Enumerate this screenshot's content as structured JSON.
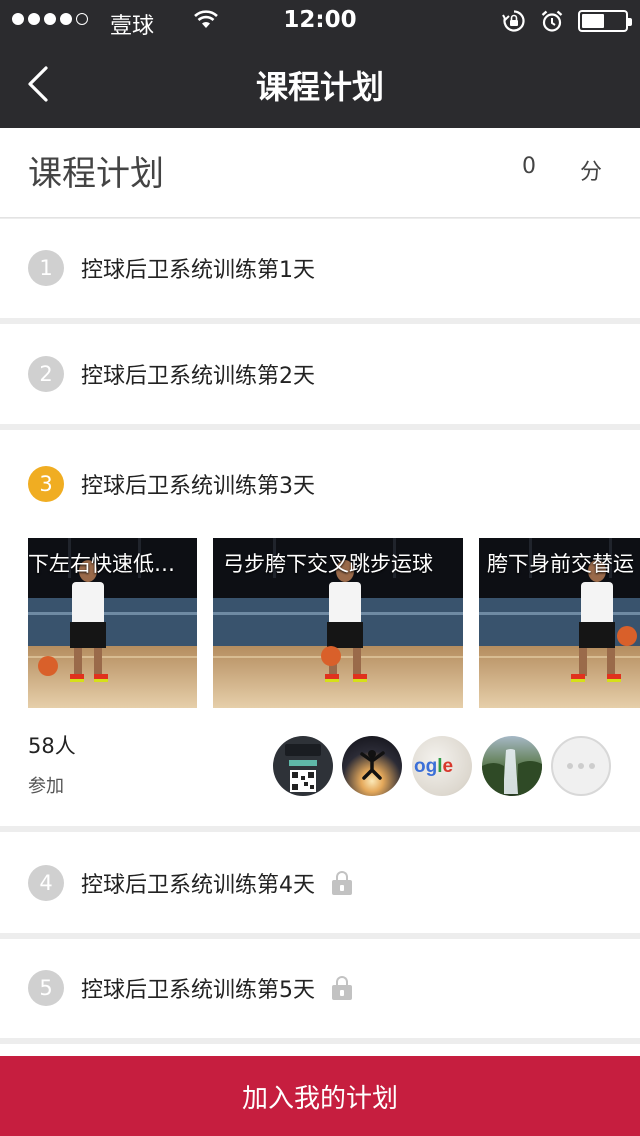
{
  "status_bar": {
    "signal_bars_filled": 4,
    "signal_bars_total": 5,
    "carrier": "壹球",
    "time": "12:00",
    "battery_level": 0.5,
    "icons": [
      "wifi-icon",
      "rotation-lock-icon",
      "alarm-icon",
      "battery-icon"
    ]
  },
  "nav": {
    "back_icon": "chevron-left-icon",
    "title": "课程计划"
  },
  "header": {
    "title": "课程计划",
    "score": "0",
    "score_unit": "分"
  },
  "days": [
    {
      "number": "1",
      "label": "控球后卫系统训练第1天",
      "state": "done",
      "locked": false
    },
    {
      "number": "2",
      "label": "控球后卫系统训练第2天",
      "state": "done",
      "locked": false
    },
    {
      "number": "3",
      "label": "控球后卫系统训练第3天",
      "state": "active",
      "locked": false
    },
    {
      "number": "4",
      "label": "控球后卫系统训练第4天",
      "state": "upcoming",
      "locked": true
    },
    {
      "number": "5",
      "label": "控球后卫系统训练第5天",
      "state": "upcoming",
      "locked": true
    }
  ],
  "active_day": {
    "videos": [
      {
        "caption": "下左右快速低…"
      },
      {
        "caption": "弓步胯下交叉跳步运球"
      },
      {
        "caption": "胯下身前交替运"
      }
    ],
    "participants_count": "58人",
    "participants_label": "参加",
    "avatars": [
      "qr-code-avatar",
      "jump-silhouette-avatar",
      "google-ball-avatar",
      "waterfall-avatar"
    ],
    "more_icon": "more-dots-icon"
  },
  "colors": {
    "nav_bg": "#2b2b2e",
    "active_badge": "#f0ad22",
    "inactive_badge": "#d0d0d0",
    "cta": "#c61e3f"
  },
  "footer": {
    "cta_label": "加入我的计划"
  }
}
